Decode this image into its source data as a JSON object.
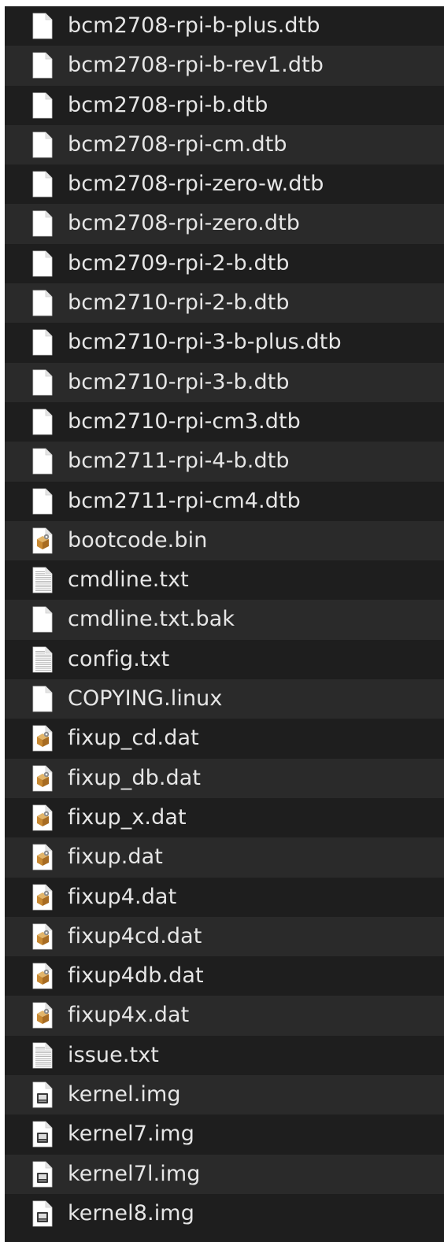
{
  "files": [
    {
      "name": "bcm2708-rpi-b-plus.dtb",
      "icon": "blank-document-icon"
    },
    {
      "name": "bcm2708-rpi-b-rev1.dtb",
      "icon": "blank-document-icon"
    },
    {
      "name": "bcm2708-rpi-b.dtb",
      "icon": "blank-document-icon"
    },
    {
      "name": "bcm2708-rpi-cm.dtb",
      "icon": "blank-document-icon"
    },
    {
      "name": "bcm2708-rpi-zero-w.dtb",
      "icon": "blank-document-icon"
    },
    {
      "name": "bcm2708-rpi-zero.dtb",
      "icon": "blank-document-icon"
    },
    {
      "name": "bcm2709-rpi-2-b.dtb",
      "icon": "blank-document-icon"
    },
    {
      "name": "bcm2710-rpi-2-b.dtb",
      "icon": "blank-document-icon"
    },
    {
      "name": "bcm2710-rpi-3-b-plus.dtb",
      "icon": "blank-document-icon"
    },
    {
      "name": "bcm2710-rpi-3-b.dtb",
      "icon": "blank-document-icon"
    },
    {
      "name": "bcm2710-rpi-cm3.dtb",
      "icon": "blank-document-icon"
    },
    {
      "name": "bcm2711-rpi-4-b.dtb",
      "icon": "blank-document-icon"
    },
    {
      "name": "bcm2711-rpi-cm4.dtb",
      "icon": "blank-document-icon"
    },
    {
      "name": "bootcode.bin",
      "icon": "package-document-icon"
    },
    {
      "name": "cmdline.txt",
      "icon": "text-document-icon"
    },
    {
      "name": "cmdline.txt.bak",
      "icon": "blank-document-icon"
    },
    {
      "name": "config.txt",
      "icon": "text-document-icon"
    },
    {
      "name": "COPYING.linux",
      "icon": "blank-document-icon"
    },
    {
      "name": "fixup_cd.dat",
      "icon": "package-document-icon"
    },
    {
      "name": "fixup_db.dat",
      "icon": "package-document-icon"
    },
    {
      "name": "fixup_x.dat",
      "icon": "package-document-icon"
    },
    {
      "name": "fixup.dat",
      "icon": "package-document-icon"
    },
    {
      "name": "fixup4.dat",
      "icon": "package-document-icon"
    },
    {
      "name": "fixup4cd.dat",
      "icon": "package-document-icon"
    },
    {
      "name": "fixup4db.dat",
      "icon": "package-document-icon"
    },
    {
      "name": "fixup4x.dat",
      "icon": "package-document-icon"
    },
    {
      "name": "issue.txt",
      "icon": "text-document-icon"
    },
    {
      "name": "kernel.img",
      "icon": "disk-image-document-icon"
    },
    {
      "name": "kernel7.img",
      "icon": "disk-image-document-icon"
    },
    {
      "name": "kernel7l.img",
      "icon": "disk-image-document-icon"
    },
    {
      "name": "kernel8.img",
      "icon": "disk-image-document-icon"
    }
  ],
  "colors": {
    "row_dark": "#1e1e1e",
    "row_light": "#2a2a2a",
    "text": "#e6e6e6"
  }
}
